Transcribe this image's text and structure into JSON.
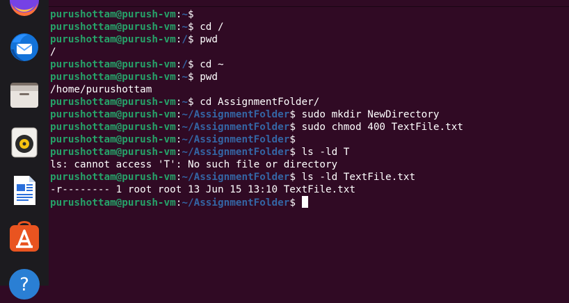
{
  "prompt": {
    "user_host": "purushottam@purush-vm",
    "separator": ":",
    "symbol": "$ "
  },
  "dock": {
    "apps": [
      {
        "name": "firefox",
        "icon": "firefox-icon"
      },
      {
        "name": "thunderbird",
        "icon": "thunderbird-icon"
      },
      {
        "name": "files",
        "icon": "files-icon"
      },
      {
        "name": "rhythmbox",
        "icon": "rhythmbox-icon"
      },
      {
        "name": "writer",
        "icon": "writer-icon"
      },
      {
        "name": "app-center",
        "icon": "app-center-icon"
      },
      {
        "name": "help",
        "icon": "help-icon",
        "glyph": "?"
      }
    ]
  },
  "terminal": {
    "lines": [
      {
        "type": "prompt",
        "path": "~",
        "cmd": ""
      },
      {
        "type": "prompt",
        "path": "~",
        "cmd": "cd /"
      },
      {
        "type": "prompt",
        "path": "/",
        "cmd": "pwd"
      },
      {
        "type": "output",
        "text": "/"
      },
      {
        "type": "prompt",
        "path": "/",
        "cmd": "cd ~"
      },
      {
        "type": "prompt",
        "path": "~",
        "cmd": "pwd"
      },
      {
        "type": "output",
        "text": "/home/purushottam"
      },
      {
        "type": "prompt",
        "path": "~",
        "cmd": "cd AssignmentFolder/"
      },
      {
        "type": "prompt",
        "path": "~/AssignmentFolder",
        "cmd": "sudo mkdir NewDirectory"
      },
      {
        "type": "prompt",
        "path": "~/AssignmentFolder",
        "cmd": "sudo chmod 400 TextFile.txt"
      },
      {
        "type": "prompt",
        "path": "~/AssignmentFolder",
        "cmd": ""
      },
      {
        "type": "prompt",
        "path": "~/AssignmentFolder",
        "cmd": "ls -ld T"
      },
      {
        "type": "output",
        "text": "ls: cannot access 'T': No such file or directory"
      },
      {
        "type": "prompt",
        "path": "~/AssignmentFolder",
        "cmd": "ls -ld TextFile.txt"
      },
      {
        "type": "output",
        "text": "-r-------- 1 root root 13 Jun 15 13:10 TextFile.txt"
      },
      {
        "type": "prompt",
        "path": "~/AssignmentFolder",
        "cmd": "",
        "cursor": true
      }
    ]
  },
  "colors": {
    "background": "#300a24",
    "user_host": "#26a269",
    "path": "#3465a4",
    "text": "#ffffff",
    "dock": "#1c1b1f"
  }
}
